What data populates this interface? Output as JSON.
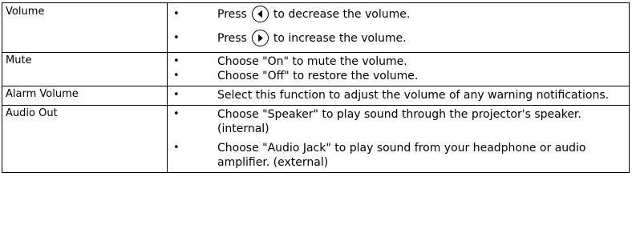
{
  "rows": [
    {
      "label": "Volume",
      "items": [
        {
          "pre": "Press",
          "icon": "left-arrow-icon",
          "post": "to decrease the volume."
        },
        {
          "pre": "Press",
          "icon": "right-arrow-icon",
          "post": "to increase the volume."
        }
      ]
    },
    {
      "label": "Mute",
      "items": [
        {
          "text": "Choose \"On\" to mute the volume."
        },
        {
          "text": "Choose \"Off\" to restore the volume."
        }
      ]
    },
    {
      "label": "Alarm Volume",
      "items": [
        {
          "text": "Select this function to adjust the volume of any warning notifications."
        }
      ]
    },
    {
      "label": "Audio Out",
      "items": [
        {
          "text": "Choose \"Speaker\" to play sound through the projector's speaker.(internal)"
        },
        {
          "text": "Choose \"Audio Jack\" to play sound from your headphone or audio amplifier. (external)"
        }
      ]
    }
  ],
  "bullet_char": "•"
}
